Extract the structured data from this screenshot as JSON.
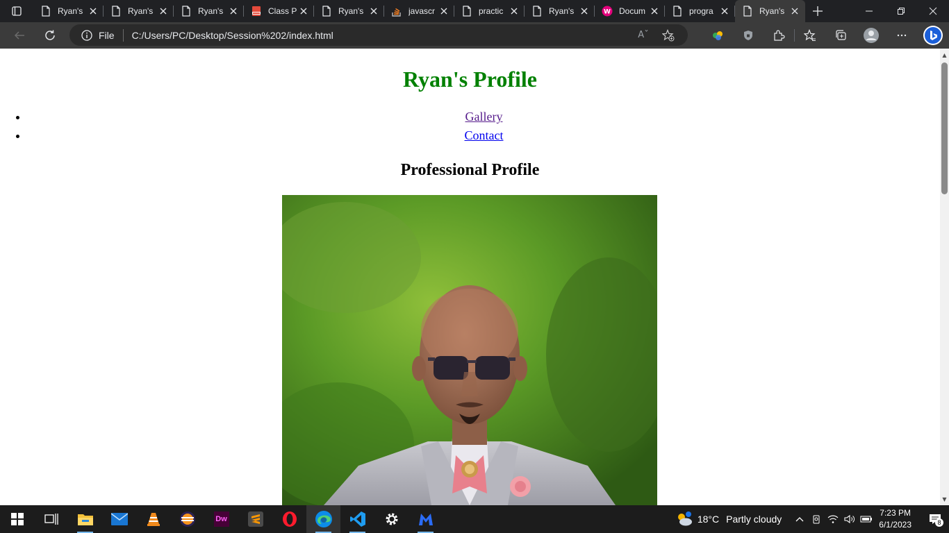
{
  "browser": {
    "tabs": [
      {
        "label": "Ryan's",
        "icon": "page-icon"
      },
      {
        "label": "Ryan's",
        "icon": "page-icon"
      },
      {
        "label": "Ryan's",
        "icon": "page-icon"
      },
      {
        "label": "Class P",
        "icon": "pdf-icon"
      },
      {
        "label": "Ryan's",
        "icon": "page-icon"
      },
      {
        "label": "javascr",
        "icon": "stackoverflow-icon"
      },
      {
        "label": "practic",
        "icon": "page-icon"
      },
      {
        "label": "Ryan's",
        "icon": "page-icon"
      },
      {
        "label": "Docum",
        "icon": "app-icon"
      },
      {
        "label": "progra",
        "icon": "page-icon"
      },
      {
        "label": "Ryan's",
        "icon": "page-icon",
        "active": true
      }
    ],
    "address": {
      "scheme": "File",
      "url": "C:/Users/PC/Desktop/Session%202/index.html"
    }
  },
  "page": {
    "title": "Ryan's Profile",
    "title_color": "#008000",
    "nav": [
      {
        "label": "Gallery",
        "visited": true
      },
      {
        "label": "Contact",
        "visited": false
      }
    ],
    "subtitle": "Professional Profile"
  },
  "taskbar": {
    "apps": [
      "start-icon",
      "task-view-icon",
      "file-explorer-icon",
      "mail-icon",
      "vlc-icon",
      "eclipse-icon",
      "dreamweaver-icon",
      "sublime-icon",
      "opera-icon",
      "edge-icon",
      "vscode-icon",
      "settings-icon",
      "malwarebytes-icon"
    ],
    "weather": {
      "temp": "18°C",
      "desc": "Partly cloudy"
    },
    "clock": {
      "time": "7:23 PM",
      "date": "6/1/2023"
    },
    "notifications": "8"
  }
}
